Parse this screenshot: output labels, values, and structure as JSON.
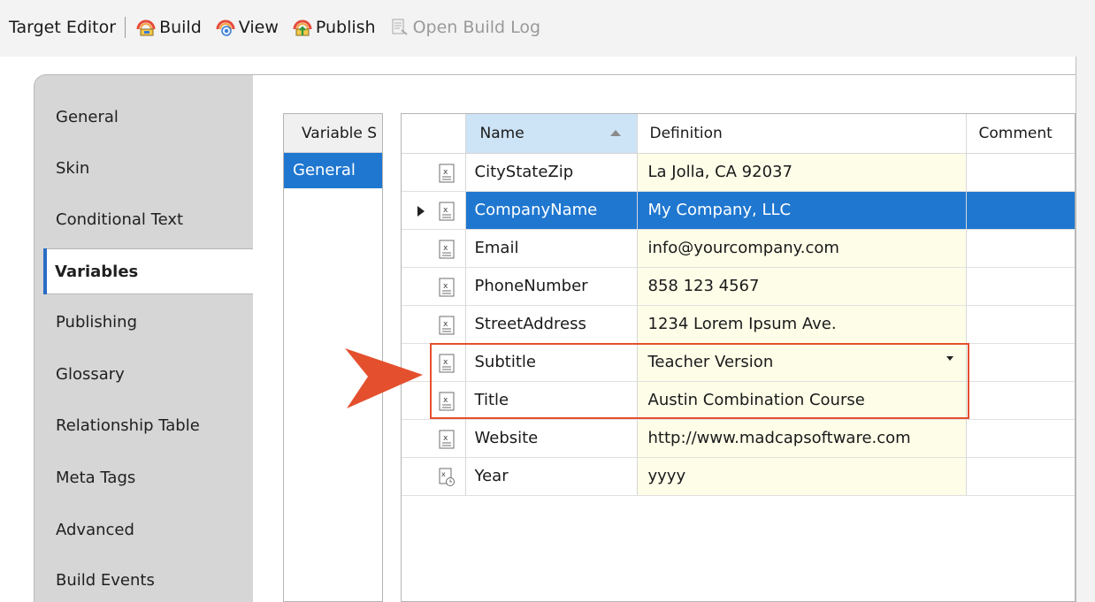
{
  "toolbar": {
    "title": "Target Editor",
    "buttons": [
      {
        "label": "Build",
        "icon": "build-icon"
      },
      {
        "label": "View",
        "icon": "view-icon"
      },
      {
        "label": "Publish",
        "icon": "publish-icon"
      },
      {
        "label": "Open Build Log",
        "icon": "build-log-icon",
        "disabled": true
      }
    ]
  },
  "nav": {
    "items": [
      {
        "label": "General"
      },
      {
        "label": "Skin"
      },
      {
        "label": "Conditional Text"
      },
      {
        "label": "Variables",
        "active": true
      },
      {
        "label": "Publishing"
      },
      {
        "label": "Glossary"
      },
      {
        "label": "Relationship Table"
      },
      {
        "label": "Meta Tags"
      },
      {
        "label": "Advanced"
      },
      {
        "label": "Build Events"
      }
    ]
  },
  "sets": {
    "header": "Variable S",
    "items": [
      "General"
    ]
  },
  "grid": {
    "columns": {
      "name": "Name",
      "definition": "Definition",
      "comment": "Comment"
    },
    "rows": [
      {
        "name": "CityStateZip",
        "definition": "La Jolla, CA 92037",
        "comment": ""
      },
      {
        "name": "CompanyName",
        "definition": "My Company, LLC",
        "comment": "",
        "selected": true
      },
      {
        "name": "Email",
        "definition": "info@yourcompany.com",
        "comment": ""
      },
      {
        "name": "PhoneNumber",
        "definition": "858 123 4567",
        "comment": ""
      },
      {
        "name": "StreetAddress",
        "definition": "1234 Lorem Ipsum Ave.",
        "comment": ""
      },
      {
        "name": "Subtitle",
        "definition": "Teacher Version",
        "comment": "",
        "dropdown": true
      },
      {
        "name": "Title",
        "definition": "Austin Combination Course",
        "comment": ""
      },
      {
        "name": "Website",
        "definition": "http://www.madcapsoftware.com",
        "comment": ""
      },
      {
        "name": "Year",
        "definition": "yyyy",
        "comment": "",
        "icon": "date-variable-icon"
      }
    ]
  },
  "colors": {
    "selection": "#1f77d0",
    "definition_bg": "#fefde8",
    "header_sorted": "#cde3f6",
    "annotation": "#e4502e"
  }
}
